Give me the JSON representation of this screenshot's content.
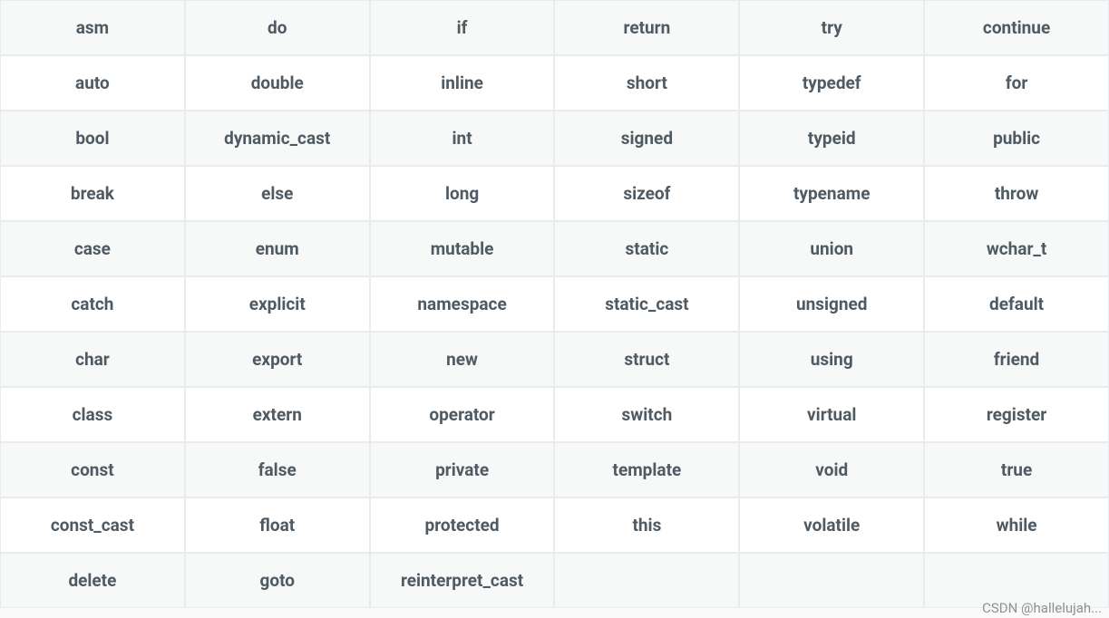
{
  "table": {
    "rows": [
      [
        "asm",
        "do",
        "if",
        "return",
        "try",
        "continue"
      ],
      [
        "auto",
        "double",
        "inline",
        "short",
        "typedef",
        "for"
      ],
      [
        "bool",
        "dynamic_cast",
        "int",
        "signed",
        "typeid",
        "public"
      ],
      [
        "break",
        "else",
        "long",
        "sizeof",
        "typename",
        "throw"
      ],
      [
        "case",
        "enum",
        "mutable",
        "static",
        "union",
        "wchar_t"
      ],
      [
        "catch",
        "explicit",
        "namespace",
        "static_cast",
        "unsigned",
        "default"
      ],
      [
        "char",
        "export",
        "new",
        "struct",
        "using",
        "friend"
      ],
      [
        "class",
        "extern",
        "operator",
        "switch",
        "virtual",
        "register"
      ],
      [
        "const",
        "false",
        "private",
        "template",
        "void",
        "true"
      ],
      [
        "const_cast",
        "float",
        "protected",
        "this",
        "volatile",
        "while"
      ],
      [
        "delete",
        "goto",
        "reinterpret_cast",
        "",
        "",
        ""
      ]
    ]
  },
  "watermark": "CSDN @hallelujah..."
}
